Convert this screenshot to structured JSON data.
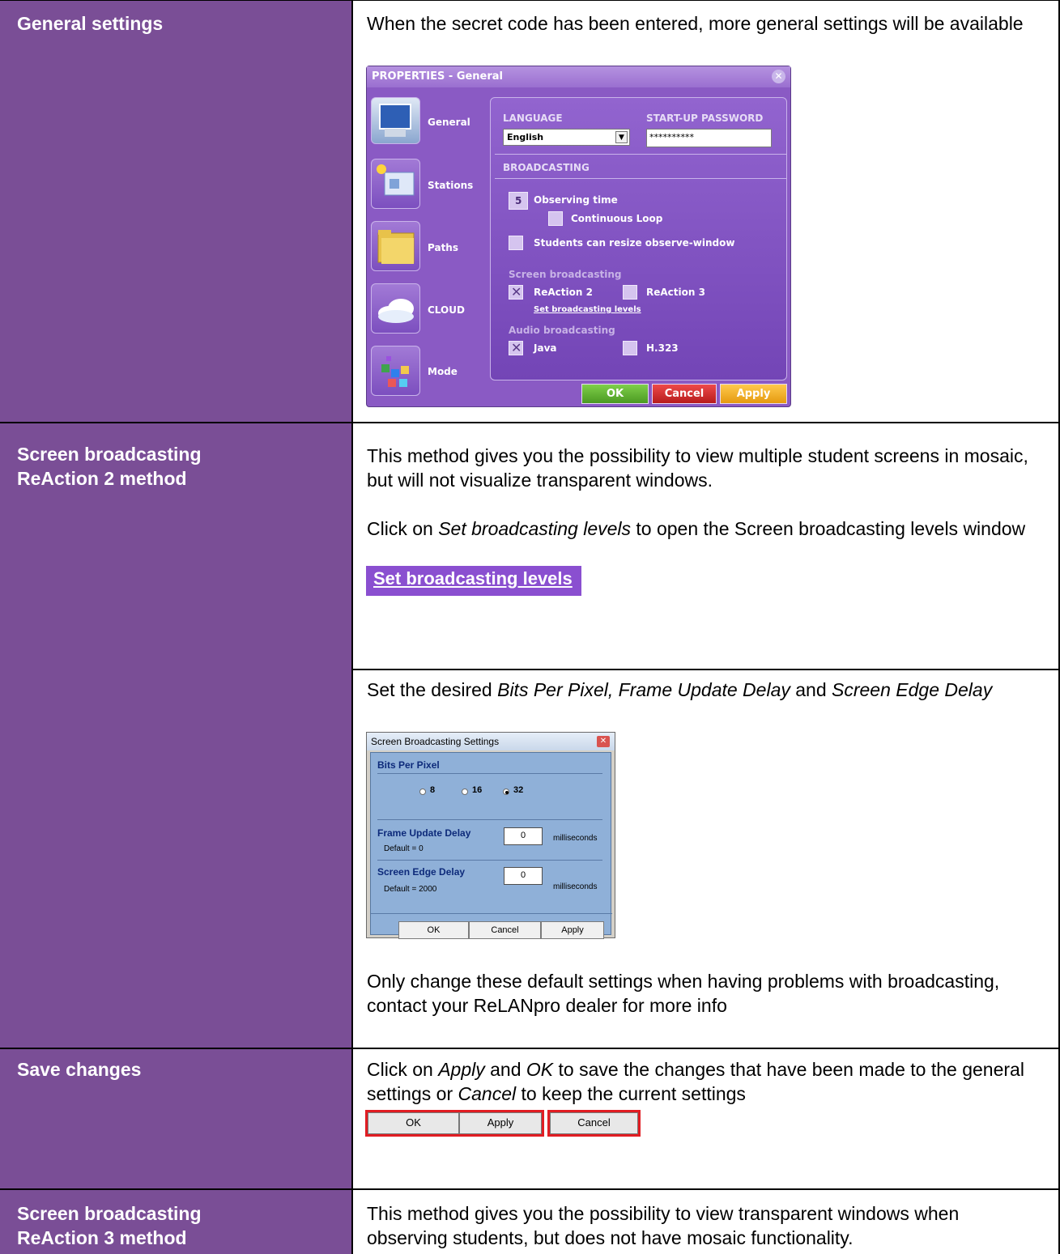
{
  "rows": {
    "general": {
      "label": "General settings",
      "text": "When the secret code has been entered, more general settings will be available"
    },
    "reaction2": {
      "label_line1": "Screen broadcasting",
      "label_line2": "ReAction 2 method",
      "text1": "This method gives you the possibility to view multiple student screens in mosaic, but will not visualize transparent windows.",
      "text2_prefix": "Click on ",
      "text2_em": "Set broadcasting levels",
      "text2_suffix": " to open the Screen broadcasting levels window",
      "link_image_label": "Set broadcasting levels",
      "text3_prefix": "Set the desired ",
      "text3_em1": "Bits Per Pixel, Frame Update Delay",
      "text3_mid": " and ",
      "text3_em2": "Screen Edge Delay",
      "text4": "Only change these default settings when having problems with broadcasting, contact your ReLANpro dealer for more info"
    },
    "save": {
      "label": "Save changes",
      "text_p1": "Click on ",
      "text_em1": "Apply",
      "text_p2": " and ",
      "text_em2": "OK",
      "text_p3": " to save the changes that have been made to the general settings or ",
      "text_em3": "Cancel",
      "text_p4": " to keep the current settings",
      "buttons": {
        "ok": "OK",
        "apply": "Apply",
        "cancel": "Cancel"
      }
    },
    "reaction3": {
      "label_line1": "Screen broadcasting",
      "label_line2": "ReAction 3 method",
      "text": "This method gives you the possibility to view transparent windows when observing students, but does not have mosaic functionality."
    }
  },
  "properties_dialog": {
    "title": "PROPERTIES - General",
    "sidebar": [
      "General",
      "Stations",
      "Paths",
      "CLOUD",
      "Mode"
    ],
    "language_header": "LANGUAGE",
    "language_value": "English",
    "password_header": "START-UP PASSWORD",
    "password_value": "**********",
    "broadcasting_header": "BROADCASTING",
    "observing_value": "5",
    "observing_label": "Observing time",
    "continuous_loop": "Continuous Loop",
    "resize_label": "Students can resize observe-window",
    "screen_broadcasting": "Screen broadcasting",
    "reaction2": "ReAction 2",
    "reaction3": "ReAction 3",
    "set_levels_link": "Set broadcasting levels",
    "audio_broadcasting": "Audio broadcasting",
    "java": "Java",
    "h323": "H.323",
    "ok": "OK",
    "cancel": "Cancel",
    "apply": "Apply"
  },
  "sbs_dialog": {
    "title": "Screen Broadcasting Settings",
    "bits_header": "Bits Per Pixel",
    "bits_options": [
      "8",
      "16",
      "32"
    ],
    "bits_selected": "32",
    "frame_header": "Frame Update Delay",
    "frame_value": "0",
    "frame_unit": "milliseconds",
    "frame_default": "Default = 0",
    "edge_header": "Screen Edge Delay",
    "edge_value": "0",
    "edge_unit": "milliseconds",
    "edge_default": "Default = 2000",
    "ok": "OK",
    "cancel": "Cancel",
    "apply": "Apply"
  }
}
